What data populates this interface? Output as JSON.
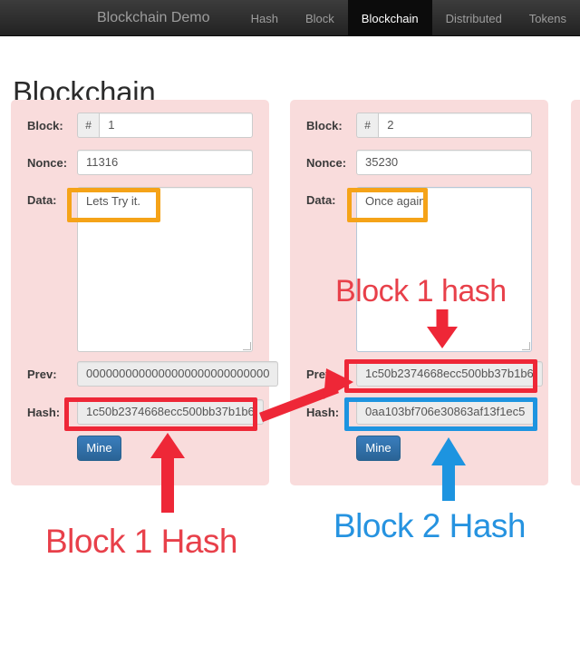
{
  "navbar": {
    "brand": "Blockchain Demo",
    "links": [
      {
        "label": "Hash",
        "active": false
      },
      {
        "label": "Block",
        "active": false
      },
      {
        "label": "Blockchain",
        "active": true
      },
      {
        "label": "Distributed",
        "active": false
      },
      {
        "label": "Tokens",
        "active": false
      }
    ]
  },
  "page": {
    "title": "Blockchain"
  },
  "labels": {
    "block": "Block:",
    "nonce": "Nonce:",
    "data": "Data:",
    "prev": "Prev:",
    "hash": "Hash:",
    "hash_addon": "#",
    "mine": "Mine"
  },
  "blocks": [
    {
      "number": "1",
      "nonce": "11316",
      "data": "Lets Try it.",
      "prev": "0000000000000000000000000000",
      "hash": "1c50b2374668ecc500bb37b1b6",
      "mine": "Mine"
    },
    {
      "number": "2",
      "nonce": "35230",
      "data": "Once again.",
      "prev": "1c50b2374668ecc500bb37b1b6",
      "hash": "0aa103bf706e30863af13f1ec5",
      "mine": "Mine"
    }
  ],
  "annotations": {
    "block1_hash_inline": "Block 1 hash",
    "block1_hash_bottom": "Block 1 Hash",
    "block2_hash_bottom": "Block 2 Hash",
    "colors": {
      "orange": "#f5a318",
      "red": "#ee2737",
      "blue": "#1d94e0"
    }
  }
}
